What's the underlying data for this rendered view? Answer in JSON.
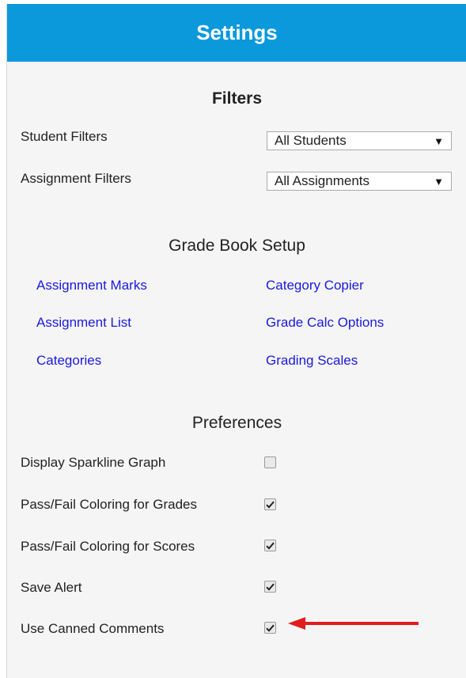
{
  "header": {
    "title": "Settings"
  },
  "filters": {
    "title": "Filters",
    "student": {
      "label": "Student Filters",
      "value": "All Students"
    },
    "assignment": {
      "label": "Assignment Filters",
      "value": "All Assignments"
    }
  },
  "gradebook": {
    "title": "Grade Book Setup",
    "links": [
      "Assignment Marks",
      "Category Copier",
      "Assignment List",
      "Grade Calc Options",
      "Categories",
      "Grading Scales"
    ]
  },
  "preferences": {
    "title": "Preferences",
    "items": [
      {
        "label": "Display Sparkline Graph",
        "checked": false
      },
      {
        "label": "Pass/Fail Coloring for Grades",
        "checked": true
      },
      {
        "label": "Pass/Fail Coloring for Scores",
        "checked": true
      },
      {
        "label": "Save Alert",
        "checked": true
      },
      {
        "label": "Use Canned Comments",
        "checked": true
      }
    ]
  },
  "annotation": {
    "arrow_color": "#e01e1e"
  },
  "icons": {
    "dropdown": "triangle-down",
    "check": "checkmark"
  }
}
